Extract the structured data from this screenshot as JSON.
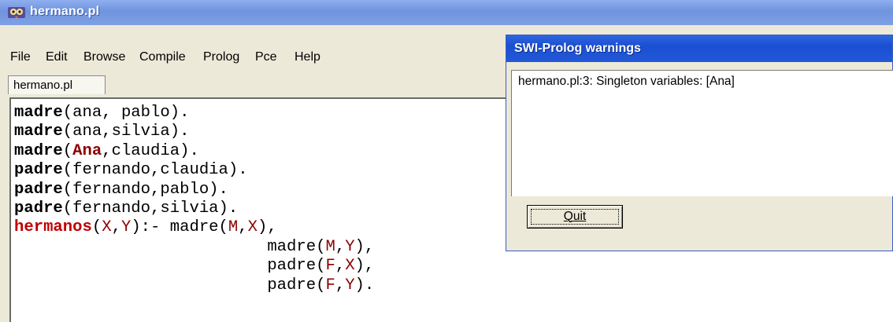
{
  "editor": {
    "title": "hermano.pl",
    "icon": "swi-prolog-owl-icon",
    "menu": [
      "File",
      "Edit",
      "Browse",
      "Compile",
      "Prolog",
      "Pce",
      "Help"
    ],
    "tab_label": "hermano.pl",
    "code_lines": [
      "madre(ana, pablo).",
      "madre(ana,silvia).",
      "madre(Ana,claudia).",
      "padre(fernando,claudia).",
      "padre(fernando,pablo).",
      "padre(fernando,silvia).",
      "hermanos(X,Y):- madre(M,X),",
      "                          madre(M,Y),",
      "                          padre(F,X),",
      "                          padre(F,Y)."
    ]
  },
  "warnings_dialog": {
    "title": "SWI-Prolog warnings",
    "message": "hermano.pl:3: Singleton variables: [Ana]",
    "quit_label": "Quit"
  },
  "colors": {
    "keyword": "#000000",
    "head_keyword": "#c00000",
    "variable": "#8b0000",
    "titlebar_active": "#1a4fd2",
    "titlebar_inactive": "#7fa0e4"
  }
}
